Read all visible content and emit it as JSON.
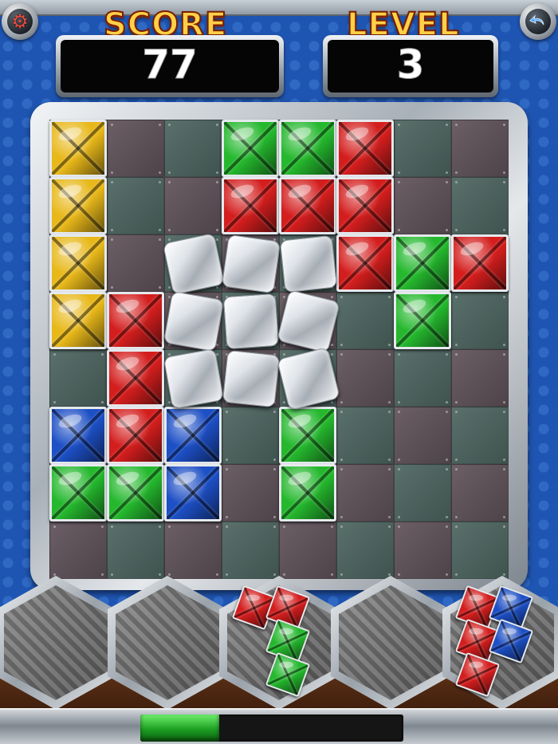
{
  "hud": {
    "score_label": "SCORE",
    "score_value": "77",
    "level_label": "LEVEL",
    "level_value": "3"
  },
  "colors": {
    "yellow": "#e8b81a",
    "green": "#25b82e",
    "red": "#d41e1e",
    "blue": "#1d4fc5"
  },
  "board": {
    "rows": 8,
    "cols": 8,
    "gems": [
      {
        "row": 0,
        "col": 0,
        "color": "yellow"
      },
      {
        "row": 0,
        "col": 3,
        "color": "green"
      },
      {
        "row": 0,
        "col": 4,
        "color": "green"
      },
      {
        "row": 0,
        "col": 5,
        "color": "red"
      },
      {
        "row": 1,
        "col": 0,
        "color": "yellow"
      },
      {
        "row": 1,
        "col": 3,
        "color": "red"
      },
      {
        "row": 1,
        "col": 4,
        "color": "red"
      },
      {
        "row": 1,
        "col": 5,
        "color": "red"
      },
      {
        "row": 2,
        "col": 0,
        "color": "yellow"
      },
      {
        "row": 2,
        "col": 5,
        "color": "red"
      },
      {
        "row": 2,
        "col": 6,
        "color": "green"
      },
      {
        "row": 2,
        "col": 7,
        "color": "red"
      },
      {
        "row": 3,
        "col": 0,
        "color": "yellow"
      },
      {
        "row": 3,
        "col": 1,
        "color": "red"
      },
      {
        "row": 3,
        "col": 6,
        "color": "green"
      },
      {
        "row": 4,
        "col": 1,
        "color": "red"
      },
      {
        "row": 5,
        "col": 0,
        "color": "blue"
      },
      {
        "row": 5,
        "col": 1,
        "color": "red"
      },
      {
        "row": 5,
        "col": 2,
        "color": "blue"
      },
      {
        "row": 5,
        "col": 4,
        "color": "green"
      },
      {
        "row": 6,
        "col": 0,
        "color": "green"
      },
      {
        "row": 6,
        "col": 1,
        "color": "green"
      },
      {
        "row": 6,
        "col": 2,
        "color": "blue"
      },
      {
        "row": 6,
        "col": 4,
        "color": "green"
      }
    ],
    "ice_blocks": [
      {
        "row": 2,
        "col": 2
      },
      {
        "row": 2,
        "col": 3
      },
      {
        "row": 2,
        "col": 4
      },
      {
        "row": 3,
        "col": 2
      },
      {
        "row": 3,
        "col": 3
      },
      {
        "row": 3,
        "col": 4
      },
      {
        "row": 4,
        "col": 2
      },
      {
        "row": 4,
        "col": 3
      },
      {
        "row": 4,
        "col": 4
      }
    ]
  },
  "tray": {
    "slots": [
      {
        "empty": true
      },
      {
        "empty": true
      },
      {
        "empty": false,
        "gems": [
          {
            "row": 0,
            "col": 0,
            "color": "red"
          },
          {
            "row": 0,
            "col": 1,
            "color": "red"
          },
          {
            "row": 1,
            "col": 1,
            "color": "green"
          },
          {
            "row": 2,
            "col": 1,
            "color": "green"
          }
        ]
      },
      {
        "empty": true
      },
      {
        "empty": false,
        "gems": [
          {
            "row": 0,
            "col": 0,
            "color": "red"
          },
          {
            "row": 0,
            "col": 1,
            "color": "blue"
          },
          {
            "row": 1,
            "col": 0,
            "color": "red"
          },
          {
            "row": 1,
            "col": 1,
            "color": "blue"
          },
          {
            "row": 2,
            "col": 0,
            "color": "red"
          }
        ]
      }
    ]
  },
  "progress": {
    "fraction": 0.3
  }
}
